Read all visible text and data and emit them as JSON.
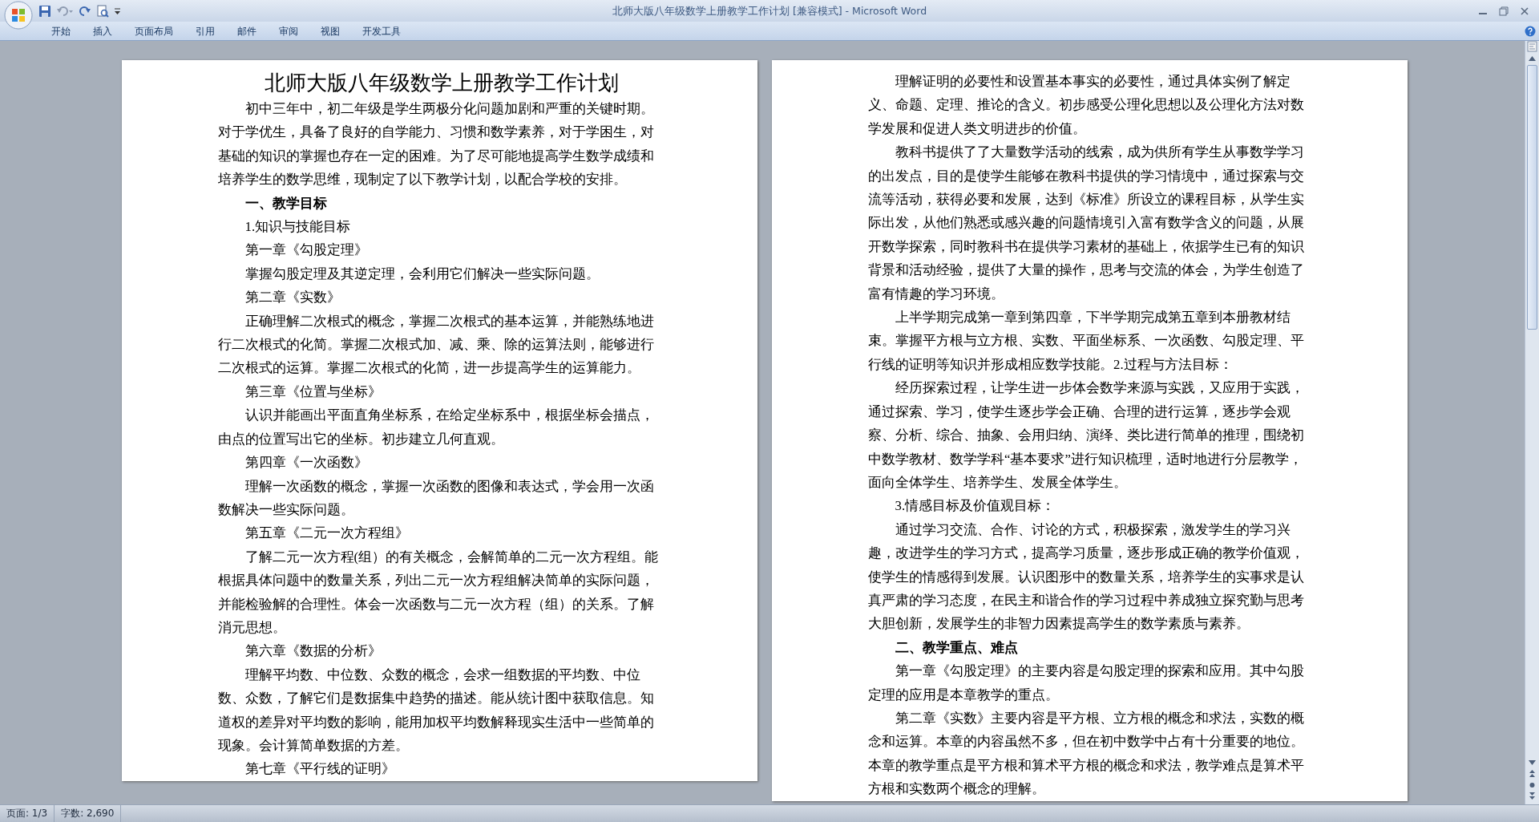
{
  "window": {
    "title": "北师大版八年级数学上册教学工作计划 [兼容模式] - Microsoft Word"
  },
  "ribbon_tabs": [
    {
      "label": "开始"
    },
    {
      "label": "插入"
    },
    {
      "label": "页面布局"
    },
    {
      "label": "引用"
    },
    {
      "label": "邮件"
    },
    {
      "label": "审阅"
    },
    {
      "label": "视图"
    },
    {
      "label": "开发工具"
    }
  ],
  "pages": [
    {
      "blocks": [
        {
          "kind": "title",
          "text": "北师大版八年级数学上册教学工作计划"
        },
        {
          "kind": "paragraph",
          "text": "初中三年中，初二年级是学生两极分化问题加剧和严重的关键时期。对于学优生，具备了良好的自学能力、习惯和数学素养，对于学困生，对基础的知识的掌握也存在一定的困难。为了尽可能地提高学生数学成绩和培养学生的数学思维，现制定了以下教学计划，以配合学校的安排。"
        },
        {
          "kind": "heading",
          "text": "一、教学目标"
        },
        {
          "kind": "paragraph",
          "text": "1.知识与技能目标"
        },
        {
          "kind": "paragraph",
          "text": "第一章《勾股定理》"
        },
        {
          "kind": "paragraph",
          "text": "掌握勾股定理及其逆定理，会利用它们解决一些实际问题。"
        },
        {
          "kind": "paragraph",
          "text": "第二章《实数》"
        },
        {
          "kind": "paragraph",
          "text": "正确理解二次根式的概念，掌握二次根式的基本运算，并能熟练地进行二次根式的化简。掌握二次根式加、减、乘、除的运算法则，能够进行二次根式的运算。掌握二次根式的化简，进一步提高学生的运算能力。"
        },
        {
          "kind": "paragraph",
          "text": "第三章《位置与坐标》"
        },
        {
          "kind": "paragraph",
          "text": "认识并能画出平面直角坐标系，在给定坐标系中，根据坐标会描点，由点的位置写出它的坐标。初步建立几何直观。"
        },
        {
          "kind": "paragraph",
          "text": "第四章《一次函数》"
        },
        {
          "kind": "paragraph",
          "text": "理解一次函数的概念，掌握一次函数的图像和表达式，学会用一次函数解决一些实际问题。"
        },
        {
          "kind": "paragraph",
          "text": "第五章《二元一次方程组》"
        },
        {
          "kind": "paragraph",
          "text": "了解二元一次方程(组）的有关概念，会解简单的二元一次方程组。能根据具体问题中的数量关系，列出二元一次方程组解决简单的实际问题，并能检验解的合理性。体会一次函数与二元一次方程（组）的关系。了解消元思想。"
        },
        {
          "kind": "paragraph",
          "text": "第六章《数据的分析》"
        },
        {
          "kind": "paragraph",
          "text": "理解平均数、中位数、众数的概念，会求一组数据的平均数、中位数、众数，了解它们是数据集中趋势的描述。能从统计图中获取信息。知道权的差异对平均数的影响，能用加权平均数解释现实生活中一些简单的现象。会计算简单数据的方差。"
        },
        {
          "kind": "paragraph",
          "text": "第七章《平行线的证明》"
        }
      ]
    },
    {
      "blocks": [
        {
          "kind": "paragraph",
          "text": "理解证明的必要性和设置基本事实的必要性，通过具体实例了解定义、命题、定理、推论的含义。初步感受公理化思想以及公理化方法对数学发展和促进人类文明进步的价值。"
        },
        {
          "kind": "paragraph",
          "text": "教科书提供了了大量数学活动的线索，成为供所有学生从事数学学习的出发点，目的是使学生能够在教科书提供的学习情境中，通过探索与交流等活动，获得必要和发展，达到《标准》所设立的课程目标，从学生实际出发，从他们熟悉或感兴趣的问题情境引入富有数学含义的问题，从展开数学探索，同时教科书在提供学习素材的基础上，依据学生已有的知识背景和活动经验，提供了大量的操作，思考与交流的体会，为学生创造了富有情趣的学习环境。"
        },
        {
          "kind": "paragraph",
          "text": "上半学期完成第一章到第四章，下半学期完成第五章到本册教材结束。掌握平方根与立方根、实数、平面坐标系、一次函数、勾股定理、平行线的证明等知识并形成相应数学技能。2.过程与方法目标："
        },
        {
          "kind": "paragraph",
          "text": "经历探索过程，让学生进一步体会数学来源与实践，又应用于实践，通过探索、学习，使学生逐步学会正确、合理的进行运算，逐步学会观察、分析、综合、抽象、会用归纳、演绎、类比进行简单的推理，围绕初中数学教材、数学学科“基本要求”进行知识梳理，适时地进行分层教学，面向全体学生、培养学生、发展全体学生。"
        },
        {
          "kind": "paragraph",
          "text": "3.情感目标及价值观目标："
        },
        {
          "kind": "paragraph",
          "text": "通过学习交流、合作、讨论的方式，积极探索，激发学生的学习兴趣，改进学生的学习方式，提高学习质量，逐步形成正确的教学价值观，使学生的情感得到发展。认识图形中的数量关系，培养学生的实事求是认真严肃的学习态度，在民主和谐合作的学习过程中养成独立探究勤与思考大胆创新，发展学生的非智力因素提高学生的数学素质与素养。"
        },
        {
          "kind": "heading",
          "text": "二、教学重点、难点"
        },
        {
          "kind": "paragraph",
          "text": "第一章《勾股定理》的主要内容是勾股定理的探索和应用。其中勾股定理的应用是本章教学的重点。"
        },
        {
          "kind": "paragraph",
          "text": "第二章《实数》主要内容是平方根、立方根的概念和求法，实数的概念和运算。本章的内容虽然不多，但在初中数学中占有十分重要的地位。本章的教学重点是平方根和算术平方根的概念和求法，教学难点是算术平方根和实数两个概念的理解。"
        }
      ]
    }
  ],
  "status_bar": {
    "page": "页面: 1/3",
    "words": "字数: 2,690"
  }
}
